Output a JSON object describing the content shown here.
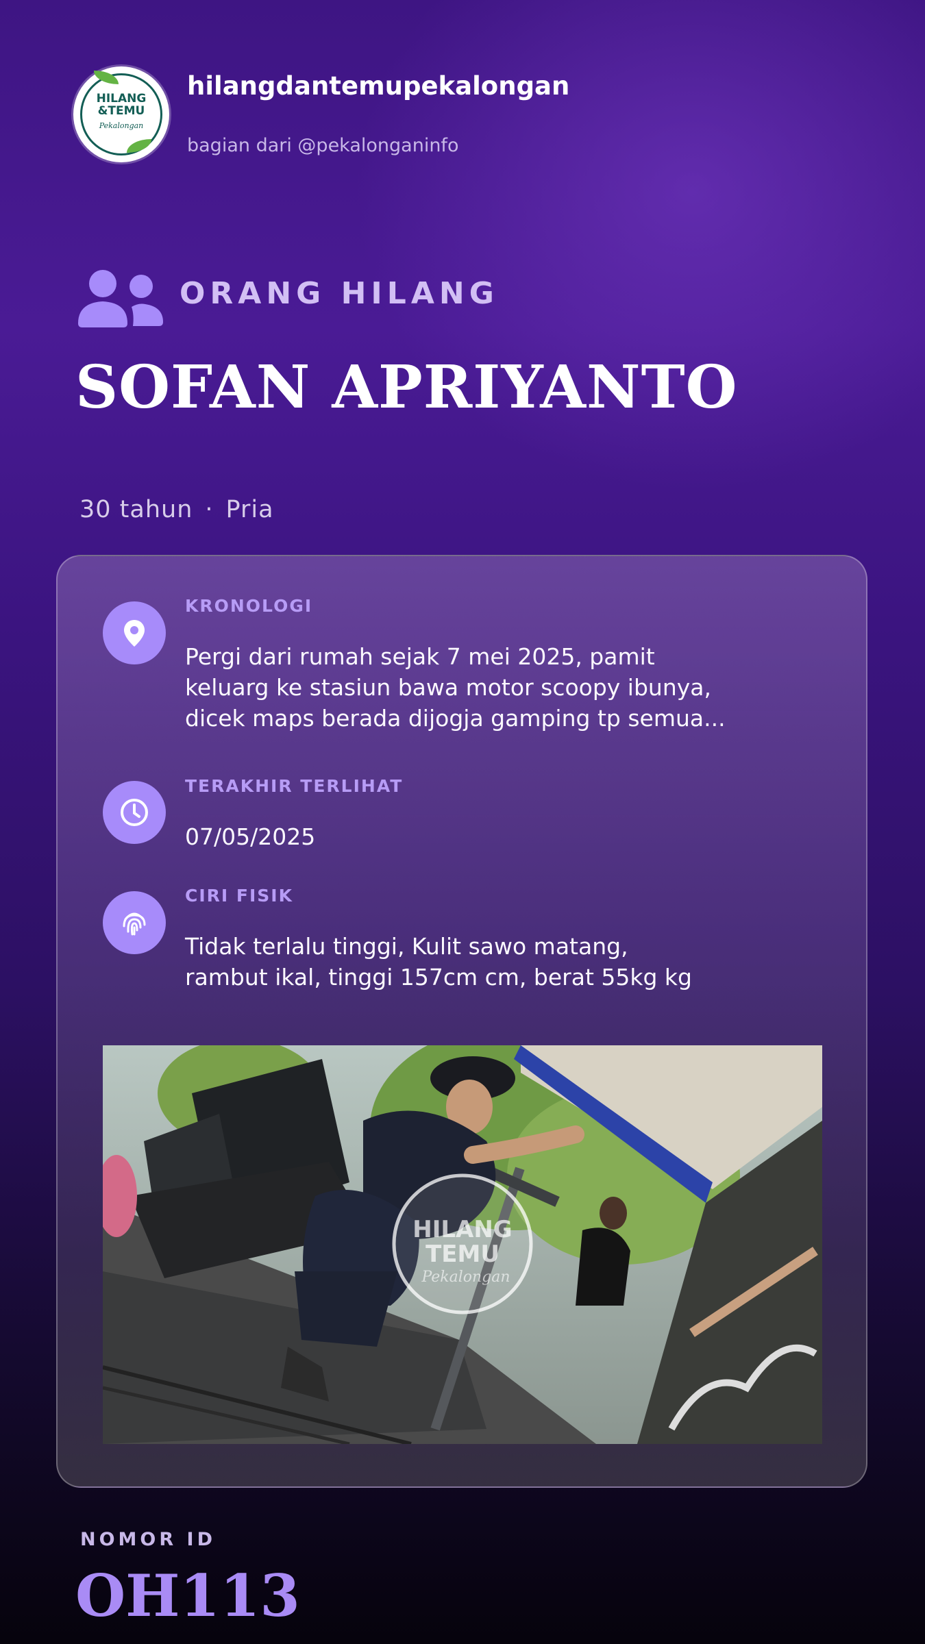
{
  "header": {
    "account_name": "hilangdantemupekalongan",
    "tagline": "bagian dari @pekalonganinfo",
    "logo_text_line1": "HILANG",
    "logo_text_line2": "&TEMU",
    "logo_text_sub": "Pekalongan"
  },
  "post": {
    "category": "ORANG HILANG",
    "category_icon": "users-icon",
    "person_name": "SOFAN APRIYANTO",
    "age": "30 tahun",
    "separator": "·",
    "gender": "Pria"
  },
  "details": [
    {
      "icon": "map-pin-icon",
      "label": "KRONOLOGI",
      "lines": [
        "Pergi dari rumah sejak 7 mei 2025, pamit",
        "keluarg ke stasiun bawa motor scoopy ibunya,",
        "dicek maps berada dijogja gamping tp semua..."
      ]
    },
    {
      "icon": "clock-icon",
      "label": "TERAKHIR TERLIHAT",
      "lines": [
        "07/05/2025"
      ]
    },
    {
      "icon": "fingerprint-icon",
      "label": "CIRI FISIK",
      "lines": [
        "Tidak terlalu tinggi, Kulit sawo matang,",
        "rambut ikal, tinggi 157cm cm, berat 55kg kg"
      ]
    }
  ],
  "photo": {
    "watermark_line1": "HILANG",
    "watermark_line2": "TEMU",
    "watermark_sub": "Pekalongan"
  },
  "footer": {
    "id_label": "NOMOR ID",
    "id_value": "OH113"
  },
  "colors": {
    "accent": "#a78bfa",
    "label": "#b79cf6",
    "background_top": "#4a1b95",
    "background_bottom": "#06030c"
  }
}
